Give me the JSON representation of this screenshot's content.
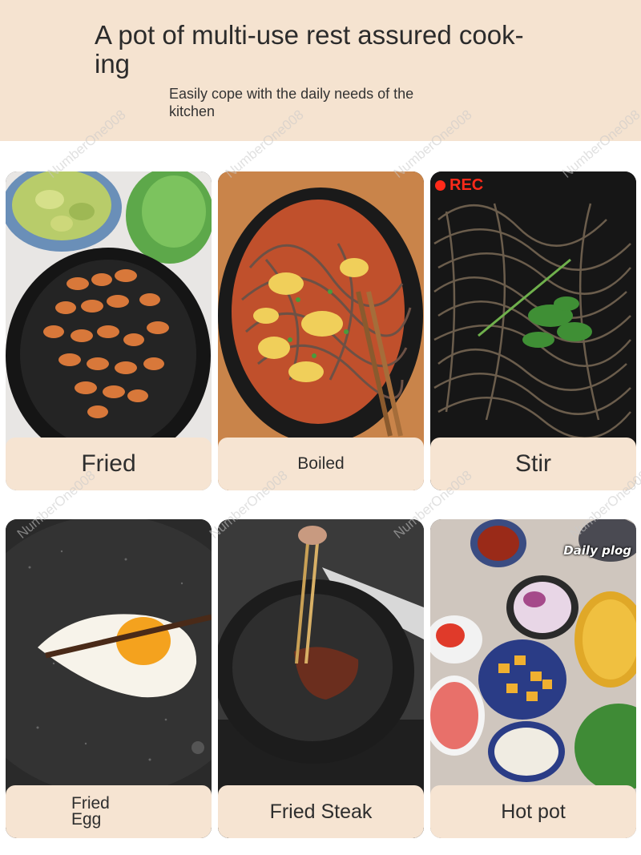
{
  "header": {
    "title": "A pot of multi-use rest assured cook-ing",
    "subtitle": "Easily cope with the daily needs of the kitchen"
  },
  "cards": [
    {
      "label": "Fried"
    },
    {
      "label": "Boiled"
    },
    {
      "label": "Stir",
      "badge": "REC"
    },
    {
      "label_line1": "Fried",
      "label_line2": "Egg"
    },
    {
      "label": "Fried Steak"
    },
    {
      "label": "Hot pot",
      "overlay": "Daily plog"
    }
  ],
  "watermark": "NumberOne008",
  "colors": {
    "header_bg": "#f5e3d0",
    "label_bg": "#f6e4d2",
    "rec_red": "#ff2a1a"
  }
}
